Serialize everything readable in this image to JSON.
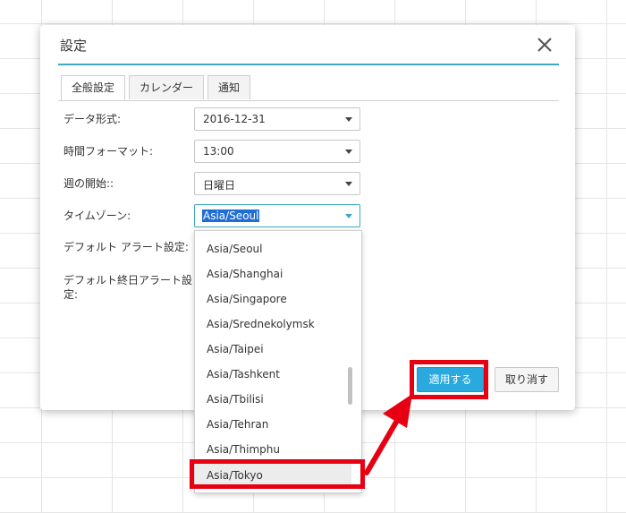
{
  "dialog": {
    "title": "設定",
    "close_icon": "close-icon"
  },
  "tabs": [
    {
      "label": "全般設定",
      "active": true
    },
    {
      "label": "カレンダー",
      "active": false
    },
    {
      "label": "通知",
      "active": false
    }
  ],
  "fields": {
    "date_format": {
      "label": "データ形式:",
      "value": "2016-12-31"
    },
    "time_format": {
      "label": "時間フォーマット:",
      "value": "13:00"
    },
    "week_start": {
      "label": "週の開始::",
      "value": "日曜日"
    },
    "timezone": {
      "label": "タイムゾーン:",
      "value": "Asia/Seoul"
    },
    "default_alert": {
      "label": "デフォルト アラート設定:"
    },
    "default_allday_alert": {
      "label_line1": "デフォルト終日アラート設",
      "label_line2": "定:"
    }
  },
  "timezone_options": [
    "Asia/Seoul",
    "Asia/Shanghai",
    "Asia/Singapore",
    "Asia/Srednekolymsk",
    "Asia/Taipei",
    "Asia/Tashkent",
    "Asia/Tbilisi",
    "Asia/Tehran",
    "Asia/Thimphu",
    "Asia/Tokyo"
  ],
  "highlighted_option": "Asia/Tokyo",
  "buttons": {
    "apply": "適用する",
    "cancel": "取り消す"
  },
  "colors": {
    "accent": "#3fa9c4",
    "apply_button": "#29a9dd",
    "annotation": "#e60012",
    "selection": "#1f6ed4"
  }
}
